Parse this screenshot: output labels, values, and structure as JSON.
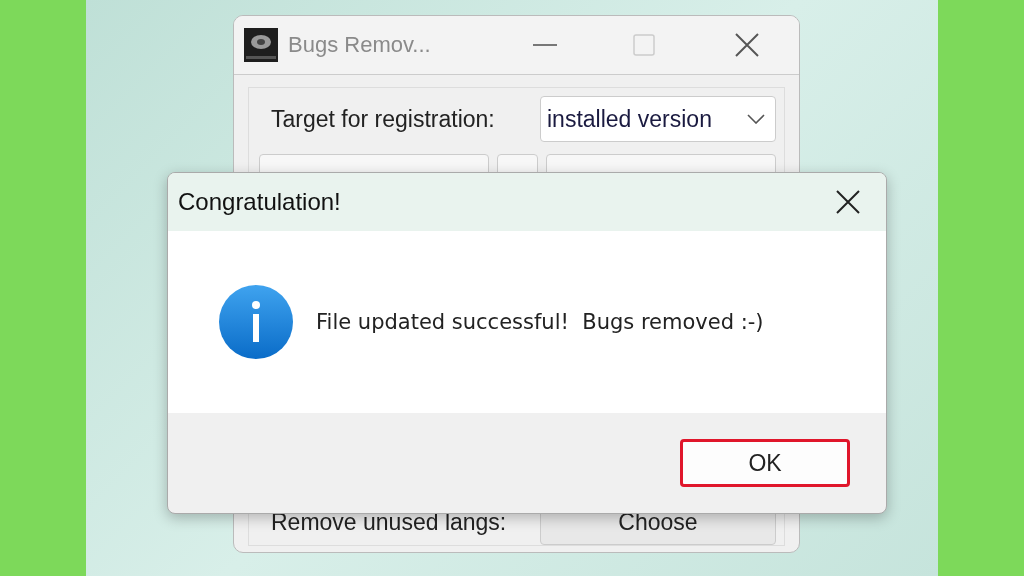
{
  "main_window": {
    "title": "Bugs Remov...",
    "target_label": "Target for registration:",
    "target_value": "installed version",
    "langs_label": "Remove unused langs:",
    "choose_button": "Choose"
  },
  "dialog": {
    "title": "Congratulation!",
    "message": "File updated successful!  Bugs removed :-)",
    "ok_button": {
      "label": "OK",
      "focused": true
    }
  }
}
